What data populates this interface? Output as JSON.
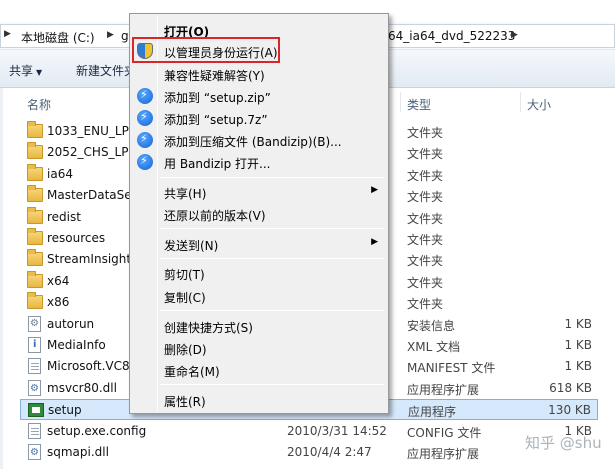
{
  "address": {
    "seg1": "本地磁盘 (C:)",
    "seg2_partial": "g",
    "seg3_partial": "64_ia64_dvd_522233"
  },
  "toolbar": {
    "share": "共享",
    "new_folder_partial": "新建文件夹"
  },
  "columns": {
    "name": "名称",
    "type": "类型",
    "size": "大小"
  },
  "files": [
    {
      "name": "1033_ENU_LP",
      "date": "",
      "type": "文件夹",
      "size": "",
      "icon": "folder"
    },
    {
      "name": "2052_CHS_LP",
      "date": "",
      "type": "文件夹",
      "size": "",
      "icon": "folder"
    },
    {
      "name": "ia64",
      "date": "",
      "type": "文件夹",
      "size": "",
      "icon": "folder"
    },
    {
      "name": "MasterDataSe",
      "date": "",
      "type": "文件夹",
      "size": "",
      "icon": "folder"
    },
    {
      "name": "redist",
      "date": "",
      "type": "文件夹",
      "size": "",
      "icon": "folder"
    },
    {
      "name": "resources",
      "date": "",
      "type": "文件夹",
      "size": "",
      "icon": "folder"
    },
    {
      "name": "StreamInsight",
      "date": "",
      "type": "文件夹",
      "size": "",
      "icon": "folder"
    },
    {
      "name": "x64",
      "date": "",
      "type": "文件夹",
      "size": "",
      "icon": "folder"
    },
    {
      "name": "x86",
      "date": "",
      "type": "文件夹",
      "size": "",
      "icon": "folder"
    },
    {
      "name": "autorun",
      "date": "",
      "type": "安装信息",
      "size": "1 KB",
      "icon": "gear-file"
    },
    {
      "name": "MediaInfo",
      "date": "",
      "type": "XML 文档",
      "size": "1 KB",
      "icon": "info-file"
    },
    {
      "name": "Microsoft.VC8",
      "date": "",
      "type": "MANIFEST 文件",
      "size": "1 KB",
      "icon": "doc-file"
    },
    {
      "name": "msvcr80.dll",
      "date": "",
      "type": "应用程序扩展",
      "size": "618 KB",
      "icon": "dll-file"
    },
    {
      "name": "setup",
      "date": "",
      "type": "应用程序",
      "size": "130 KB",
      "icon": "setup-app",
      "selected": true
    },
    {
      "name": "setup.exe.config",
      "date": "2010/3/31 14:52",
      "type": "CONFIG 文件",
      "size": "1 KB",
      "icon": "doc-file"
    },
    {
      "name": "sqmapi.dll",
      "date": "2010/4/4 2:47",
      "type": "应用程序扩展",
      "size": "",
      "icon": "dll-file"
    }
  ],
  "menu": {
    "open": "打开(O)",
    "run_as_admin": "以管理员身份运行(A)",
    "compat": "兼容性疑难解答(Y)",
    "add_zip": "添加到 “setup.zip”",
    "add_7z": "添加到 “setup.7z”",
    "add_archive": "添加到压缩文件 (Bandizip)(B)...",
    "open_bandizip": "用 Bandizip 打开...",
    "share": "共享(H)",
    "restore": "还原以前的版本(V)",
    "send_to": "发送到(N)",
    "cut": "剪切(T)",
    "copy": "复制(C)",
    "shortcut": "创建快捷方式(S)",
    "delete": "删除(D)",
    "rename": "重命名(M)",
    "properties": "属性(R)"
  },
  "watermark": "知乎 @shu",
  "colors": {
    "highlight": "#d9262b",
    "selection": "#d6e8fb",
    "menu_bg": "#f0f0f0"
  }
}
